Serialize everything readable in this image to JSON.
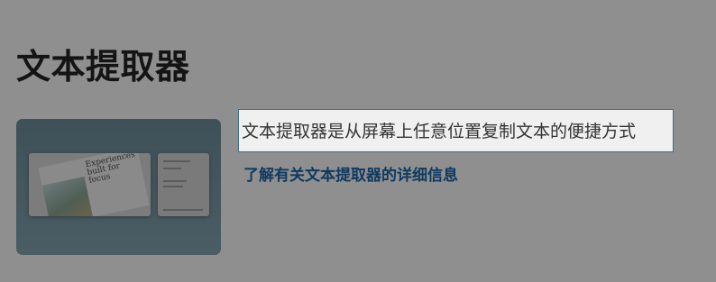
{
  "page": {
    "title": "文本提取器"
  },
  "preview": {
    "heading_line1": "Experiences",
    "heading_line2": "built for focus"
  },
  "description": {
    "text": "文本提取器是从屏幕上任意位置复制文本的便捷方式"
  },
  "learn_more": {
    "label": "了解有关文本提取器的详细信息"
  },
  "colors": {
    "background": "#8f8f8f",
    "title": "#141414",
    "link": "#0f3a60",
    "box_border": "#3e6f8d",
    "box_fill": "#f0f0f0"
  }
}
